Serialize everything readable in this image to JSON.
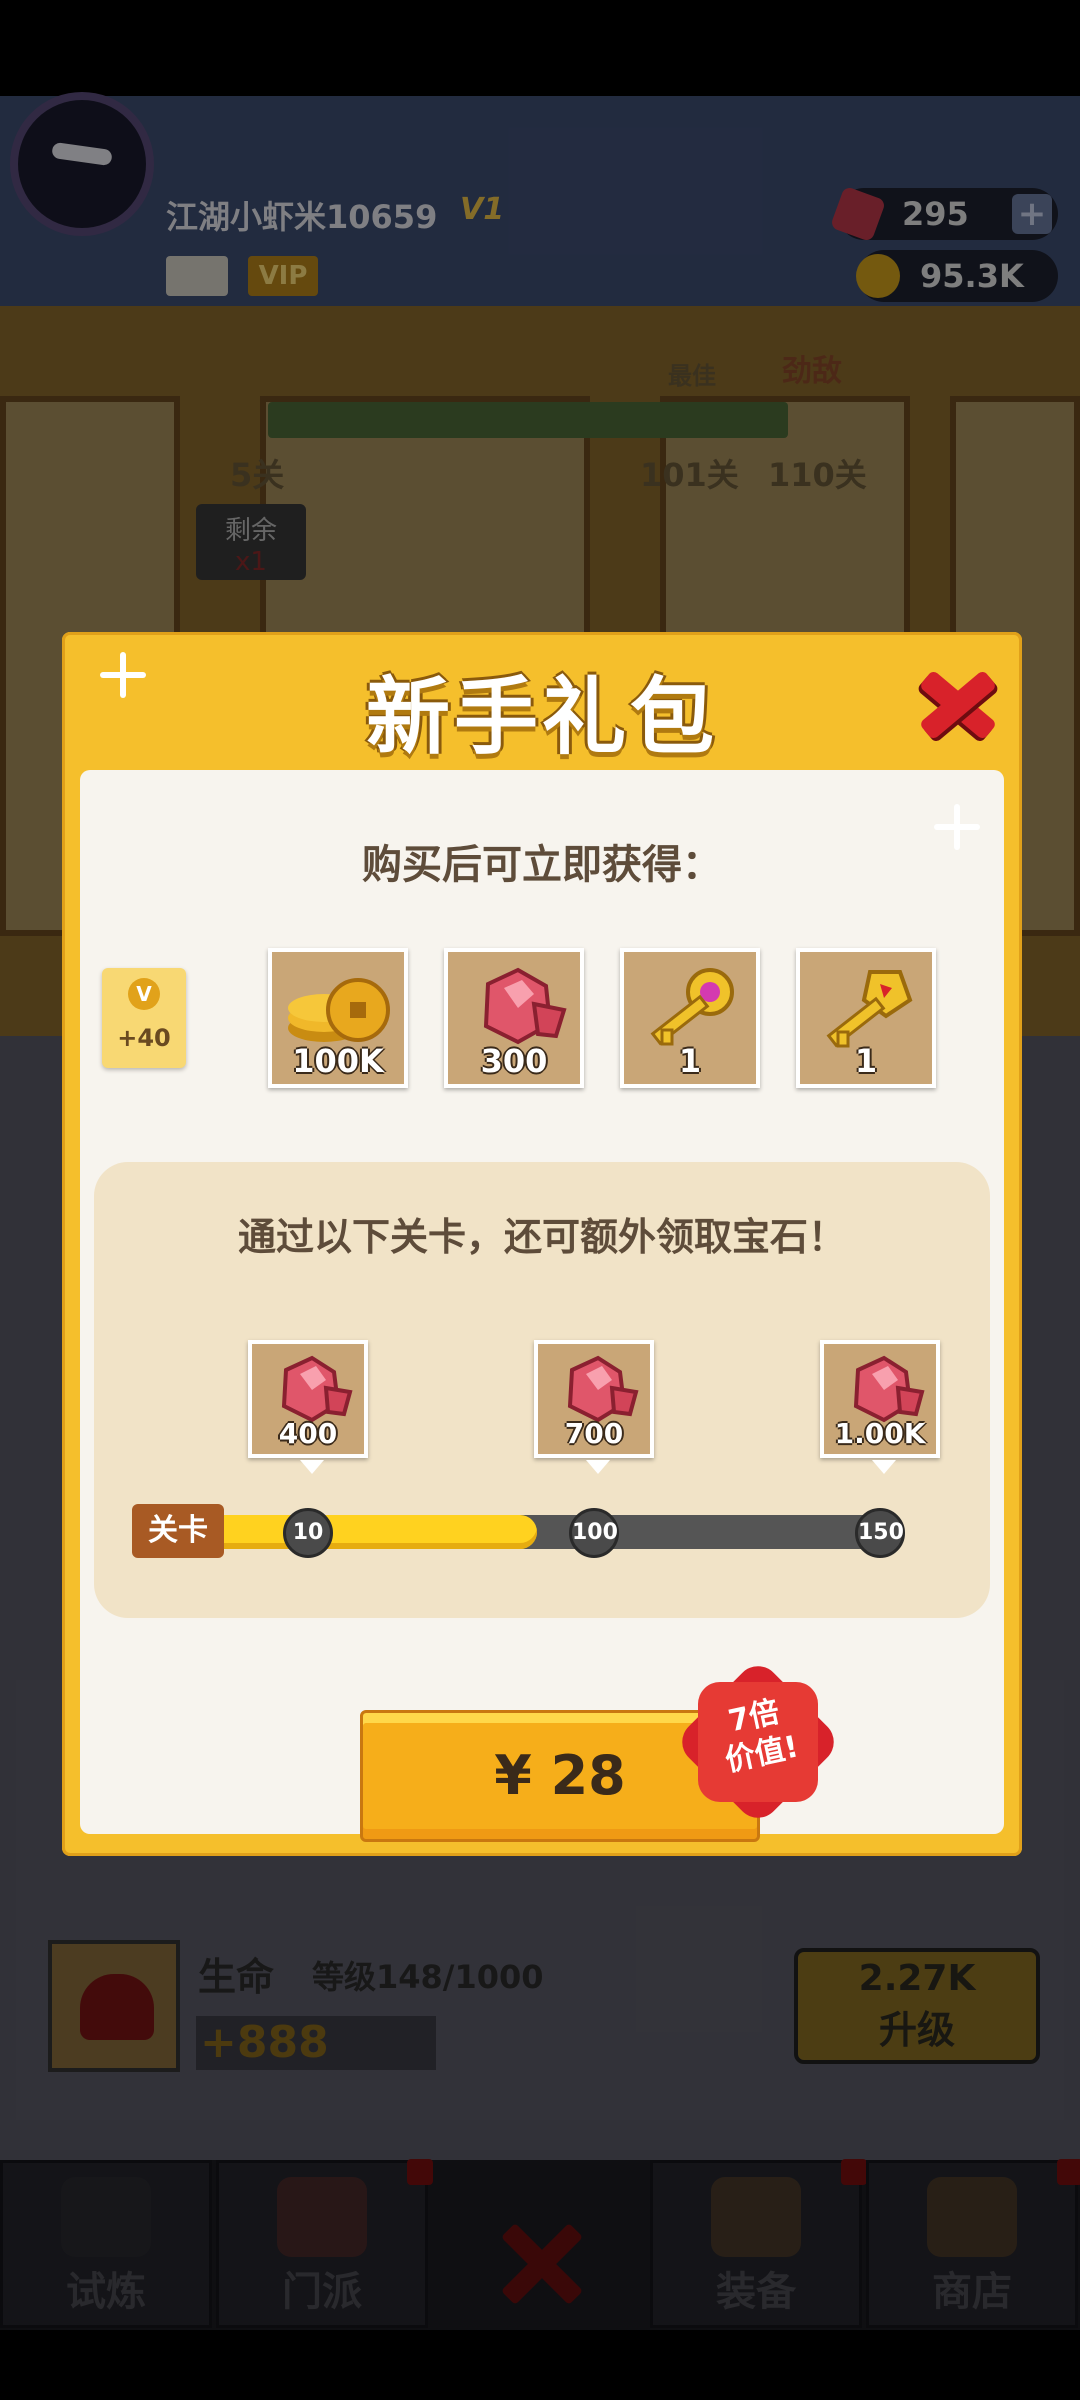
{
  "player": {
    "name": "江湖小虾米10659",
    "vip_level": "V1",
    "vip_badge": "VIP"
  },
  "resources": {
    "gems": "295",
    "gold": "95.3K",
    "add_symbol": "+"
  },
  "stage_progress": {
    "best_label": "最佳",
    "rival_label": "劲敌",
    "current": "5关",
    "best": "101关",
    "rival": "110关",
    "remaining_label": "剩余",
    "remaining_count": "x1"
  },
  "modal": {
    "title": "新手礼包",
    "subtitle": "购买后可立即获得：",
    "vip_tag": {
      "icon": "V",
      "points": "+40"
    },
    "rewards": [
      {
        "icon": "gold-coins-icon",
        "count": "100K"
      },
      {
        "icon": "ruby-gem-icon",
        "count": "300"
      },
      {
        "icon": "pink-gem-key-icon",
        "count": "1"
      },
      {
        "icon": "gold-key-icon",
        "count": "1"
      }
    ],
    "stage_bonus": {
      "title": "通过以下关卡，还可额外领取宝石！",
      "chip_label": "关卡",
      "rewards": [
        {
          "count": "400"
        },
        {
          "count": "700"
        },
        {
          "count": "1.00K"
        }
      ],
      "nodes": [
        "10",
        "100",
        "150"
      ],
      "progress_fraction": 0.49
    },
    "buy_price": "¥ 28",
    "value_badge": [
      "7倍",
      "价值!"
    ]
  },
  "life_stat": {
    "title": "生命",
    "level": "等级148/1000",
    "bonus": "+888",
    "upgrade_cost": "2.27K",
    "upgrade_label": "升级"
  },
  "nav": {
    "items": [
      "试炼",
      "门派",
      "装备",
      "商店"
    ]
  },
  "colors": {
    "modal_frame": "#f5bf2c",
    "close_red": "#d8222a",
    "buy_orange": "#f6ae1a",
    "progress_yellow": "#ffd21f"
  }
}
